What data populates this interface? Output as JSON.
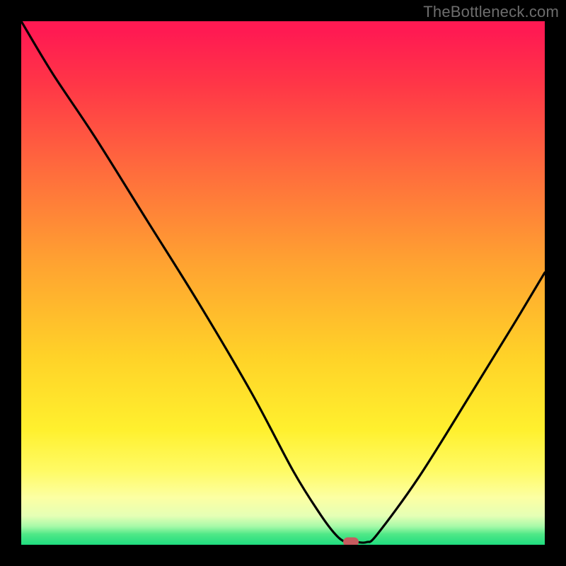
{
  "watermark": "TheBottleneck.com",
  "colors": {
    "frame_bg": "#000000",
    "curve": "#000000",
    "marker": "#c75b5f",
    "watermark": "#6d6d6d"
  },
  "chart_data": {
    "type": "line",
    "title": "",
    "xlabel": "",
    "ylabel": "",
    "xlim": [
      0,
      100
    ],
    "ylim": [
      0,
      100
    ],
    "grid": false,
    "legend": false,
    "series": [
      {
        "name": "bottleneck-curve",
        "x": [
          0,
          6,
          14,
          24,
          34,
          44,
          52,
          57,
          60,
          62,
          64,
          66,
          68,
          76,
          86,
          94,
          100
        ],
        "y": [
          100,
          90,
          78,
          62,
          46,
          29,
          14,
          6,
          2,
          0.5,
          0.5,
          0.5,
          2,
          13,
          29,
          42,
          52
        ]
      }
    ],
    "marker": {
      "x": 63,
      "y": 0.5
    },
    "background_gradient_stops": [
      {
        "pos": 0.0,
        "color": "#ff1a52"
      },
      {
        "pos": 0.28,
        "color": "#ff6a3d"
      },
      {
        "pos": 0.64,
        "color": "#ffd228"
      },
      {
        "pos": 0.86,
        "color": "#fffb66"
      },
      {
        "pos": 0.95,
        "color": "#e5ffb5"
      },
      {
        "pos": 1.0,
        "color": "#1fdc7f"
      }
    ]
  }
}
